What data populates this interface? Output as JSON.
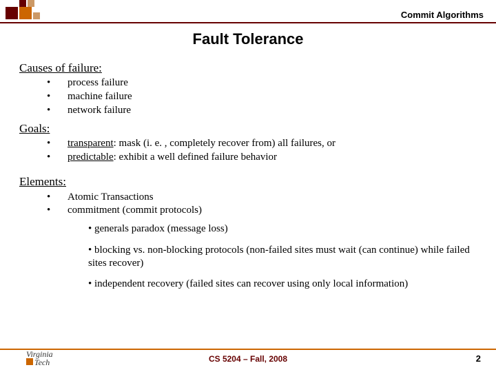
{
  "header": {
    "label": "Commit Algorithms"
  },
  "title": "Fault Tolerance",
  "sections": {
    "causes": {
      "heading": "Causes of failure:",
      "items": [
        "process failure",
        "machine failure",
        "network failure"
      ]
    },
    "goals": {
      "heading": "Goals:",
      "items": [
        {
          "term": "transparent",
          "rest": ": mask (i. e. , completely recover from) all failures, or"
        },
        {
          "term": "predictable",
          "rest": ": exhibit a well defined failure behavior"
        }
      ]
    },
    "elements": {
      "heading": "Elements:",
      "items": [
        "Atomic Transactions",
        "commitment (commit protocols)"
      ],
      "subitems": [
        "• generals paradox (message loss)",
        "• blocking vs. non-blocking protocols (non-failed sites must wait (can continue) while failed sites recover)",
        "• independent recovery (failed sites can recover using only local information)"
      ]
    }
  },
  "footer": {
    "logo1": "Virginia",
    "logo2": "Tech",
    "center": "CS 5204 – Fall, 2008",
    "page": "2"
  }
}
